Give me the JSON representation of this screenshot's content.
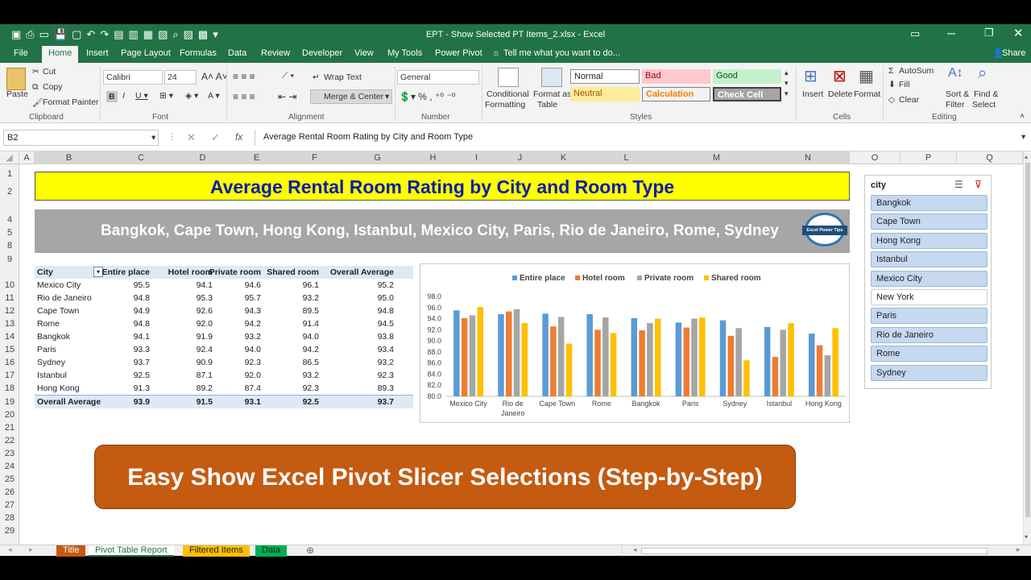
{
  "window": {
    "title": "EPT - Show Selected PT Items_2.xlsx - Excel"
  },
  "ribbon_tabs": [
    "File",
    "Home",
    "Insert",
    "Page Layout",
    "Formulas",
    "Data",
    "Review",
    "Developer",
    "View",
    "My Tools",
    "Power Pivot"
  ],
  "tell_me": "Tell me what you want to do...",
  "share_label": "Share",
  "clipboard": {
    "paste": "Paste",
    "cut": "Cut",
    "copy": "Copy",
    "format_painter": "Format Painter",
    "label": "Clipboard"
  },
  "font": {
    "name": "Calibri",
    "size": "24",
    "label": "Font"
  },
  "alignment": {
    "wrap": "Wrap Text",
    "merge": "Merge & Center",
    "label": "Alignment"
  },
  "number": {
    "format": "General",
    "label": "Number"
  },
  "styles": {
    "conditional": "Conditional",
    "formatting": "Formatting",
    "format_as": "Format as",
    "table": "Table",
    "normal": "Normal",
    "bad": "Bad",
    "good": "Good",
    "neutral": "Neutral",
    "calculation": "Calculation",
    "check_cell": "Check Cell",
    "label": "Styles"
  },
  "cells": {
    "insert": "Insert",
    "delete": "Delete",
    "format": "Format",
    "label": "Cells"
  },
  "editing": {
    "autosum": "AutoSum",
    "fill": "Fill",
    "clear": "Clear",
    "sort": "Sort &",
    "filter": "Filter",
    "find": "Find &",
    "select": "Select",
    "label": "Editing"
  },
  "formula_bar": {
    "name_box": "B2",
    "content": "Average Rental Room Rating by City and Room Type"
  },
  "columns": [
    "A",
    "B",
    "C",
    "D",
    "E",
    "F",
    "G",
    "H",
    "I",
    "J",
    "K",
    "L",
    "M",
    "N",
    "O",
    "P",
    "Q"
  ],
  "rows": [
    "1",
    "2",
    "4",
    "5",
    "8",
    "9",
    "10",
    "11",
    "12",
    "13",
    "14",
    "15",
    "16",
    "17",
    "18",
    "19",
    "20",
    "21",
    "22",
    "23",
    "24",
    "25",
    "26",
    "27",
    "28",
    "29"
  ],
  "title_text": "Average Rental Room Rating by City and Room Type",
  "city_banner": "Bangkok, Cape Town, Hong Kong, Istanbul, Mexico City, Paris, Rio de Janeiro, Rome, Sydney",
  "logo_text": "Excel Power Tips",
  "pivot": {
    "headers": [
      "City",
      "Entire place",
      "Hotel room",
      "Private room",
      "Shared room",
      "Overall Average"
    ],
    "rows": [
      [
        "Mexico City",
        "95.5",
        "94.1",
        "94.6",
        "96.1",
        "95.2"
      ],
      [
        "Rio de Janeiro",
        "94.8",
        "95.3",
        "95.7",
        "93.2",
        "95.0"
      ],
      [
        "Cape Town",
        "94.9",
        "92.6",
        "94.3",
        "89.5",
        "94.8"
      ],
      [
        "Rome",
        "94.8",
        "92.0",
        "94.2",
        "91.4",
        "94.5"
      ],
      [
        "Bangkok",
        "94.1",
        "91.9",
        "93.2",
        "94.0",
        "93.8"
      ],
      [
        "Paris",
        "93.3",
        "92.4",
        "94.0",
        "94.2",
        "93.4"
      ],
      [
        "Sydney",
        "93.7",
        "90.9",
        "92.3",
        "86.5",
        "93.2"
      ],
      [
        "Istanbul",
        "92.5",
        "87.1",
        "92.0",
        "93.2",
        "92.3"
      ],
      [
        "Hong Kong",
        "91.3",
        "89.2",
        "87.4",
        "92.3",
        "89.3"
      ]
    ],
    "total": [
      "Overall Average",
      "93.9",
      "91.5",
      "93.1",
      "92.5",
      "93.7"
    ]
  },
  "chart_data": {
    "type": "bar",
    "categories": [
      "Mexico City",
      "Rio de Janeiro",
      "Cape Town",
      "Rome",
      "Bangkok",
      "Paris",
      "Sydney",
      "Istanbul",
      "Hong Kong"
    ],
    "category_lines": [
      [
        "Mexico City"
      ],
      [
        "Rio de",
        "Janeiro"
      ],
      [
        "Cape Town"
      ],
      [
        "Rome"
      ],
      [
        "Bangkok"
      ],
      [
        "Paris"
      ],
      [
        "Sydney"
      ],
      [
        "Istanbul"
      ],
      [
        "Hong Kong"
      ]
    ],
    "series": [
      {
        "name": "Entire place",
        "color": "#5b9bd5",
        "values": [
          95.5,
          94.8,
          94.9,
          94.8,
          94.1,
          93.3,
          93.7,
          92.5,
          91.3
        ]
      },
      {
        "name": "Hotel room",
        "color": "#ed7d31",
        "values": [
          94.1,
          95.3,
          92.6,
          92.0,
          91.9,
          92.4,
          90.9,
          87.1,
          89.2
        ]
      },
      {
        "name": "Private room",
        "color": "#a5a5a5",
        "values": [
          94.6,
          95.7,
          94.3,
          94.2,
          93.2,
          94.0,
          92.3,
          92.0,
          87.4
        ]
      },
      {
        "name": "Shared room",
        "color": "#ffc000",
        "values": [
          96.1,
          93.2,
          89.5,
          91.4,
          94.0,
          94.2,
          86.5,
          93.2,
          92.3
        ]
      }
    ],
    "ylim": [
      80,
      98
    ],
    "yticks": [
      "80.0",
      "82.0",
      "84.0",
      "86.0",
      "88.0",
      "90.0",
      "92.0",
      "94.0",
      "96.0",
      "98.0"
    ],
    "legend": "top"
  },
  "slicer": {
    "title": "city",
    "items": [
      {
        "label": "Bangkok",
        "selected": true
      },
      {
        "label": "Cape Town",
        "selected": true
      },
      {
        "label": "Hong Kong",
        "selected": true
      },
      {
        "label": "Istanbul",
        "selected": true
      },
      {
        "label": "Mexico City",
        "selected": true
      },
      {
        "label": "New York",
        "selected": false
      },
      {
        "label": "Paris",
        "selected": true
      },
      {
        "label": "Rio de Janeiro",
        "selected": true
      },
      {
        "label": "Rome",
        "selected": true
      },
      {
        "label": "Sydney",
        "selected": true
      }
    ]
  },
  "banner_text": "Easy Show Excel Pivot Slicer Selections (Step-by-Step)",
  "sheet_tabs": [
    {
      "label": "Title",
      "color": "#c55a11",
      "text": "#ffffff"
    },
    {
      "label": "Pivot Table Report",
      "color": "#ffffff",
      "text": "#217346"
    },
    {
      "label": "Filtered Items",
      "color": "#ffc000",
      "text": "#222222"
    },
    {
      "label": "Data",
      "color": "#00b050",
      "text": "#222222"
    }
  ],
  "colors": {
    "excel_green": "#217346",
    "title_blue": "#0b1ea8",
    "banner_orange": "#c55a11"
  }
}
